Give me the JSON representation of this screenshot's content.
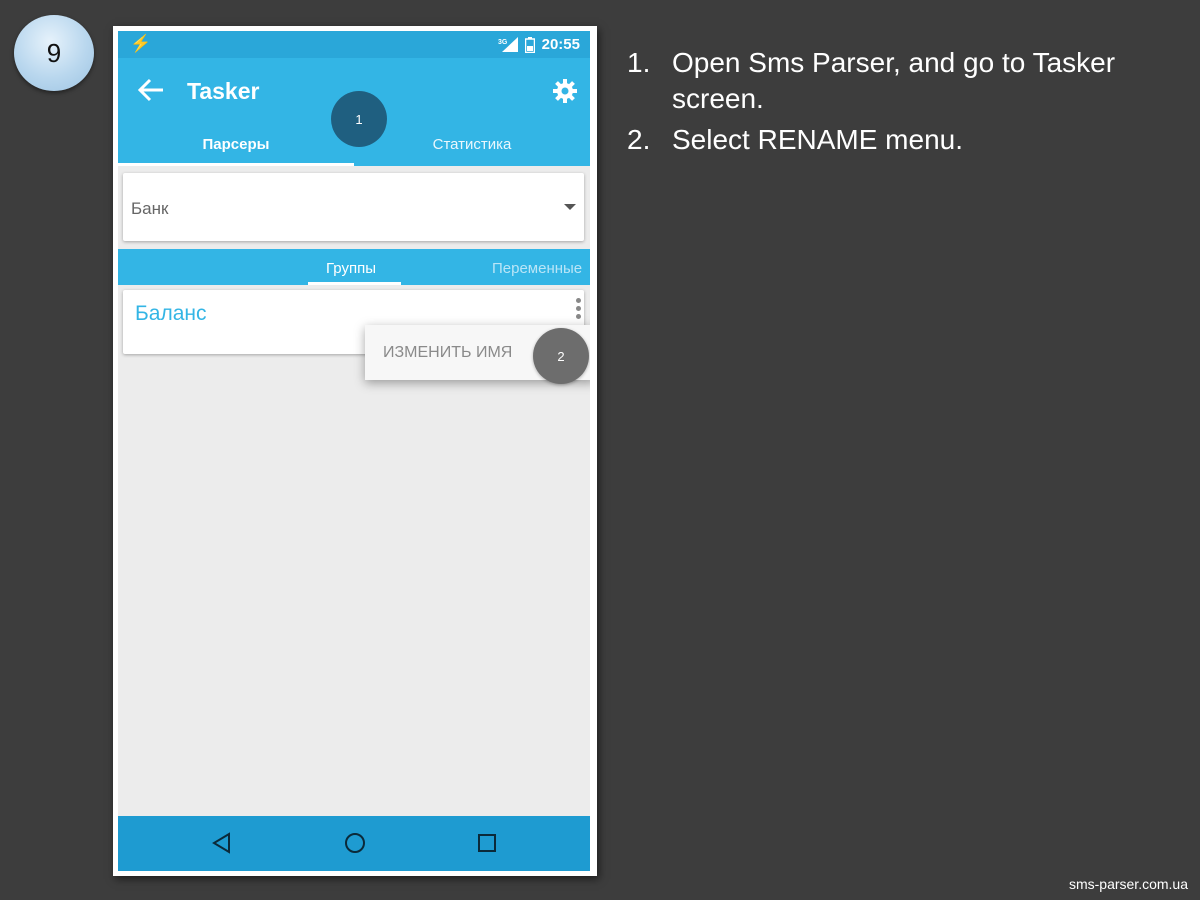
{
  "slide_number": "9",
  "status_bar": {
    "time": "20:55",
    "network": "3G"
  },
  "toolbar": {
    "title": "Tasker",
    "tabs": [
      {
        "label": "Парсеры",
        "active": true
      },
      {
        "label": "Статистика",
        "active": false
      }
    ]
  },
  "markers": {
    "first": "1",
    "second": "2"
  },
  "spinner": {
    "value": "Банк"
  },
  "subtabs": [
    {
      "label": "Группы",
      "active": true
    },
    {
      "label": "Переменные",
      "active": false
    }
  ],
  "list": {
    "item_title": "Баланс"
  },
  "popup": {
    "item": "ИЗМЕНИТЬ ИМЯ"
  },
  "instructions": [
    {
      "num": "1.",
      "text": "Open Sms Parser, and go to Tasker screen."
    },
    {
      "num": "2.",
      "text": "Select RENAME menu."
    }
  ],
  "footer": "sms-parser.com.ua",
  "colors": {
    "background": "#3d3d3d",
    "app_primary": "#33b5e5",
    "status_bar": "#2aa7d9",
    "nav_bar": "#1e9bd1",
    "marker_1": "#1f5f80",
    "marker_2": "#6d6d6d"
  },
  "icons": [
    "flash-icon",
    "signal-icon",
    "battery-icon",
    "back-arrow-icon",
    "gear-icon",
    "dropdown-arrow-icon",
    "overflow-menu-icon",
    "nav-back-icon",
    "nav-home-icon",
    "nav-recents-icon"
  ]
}
